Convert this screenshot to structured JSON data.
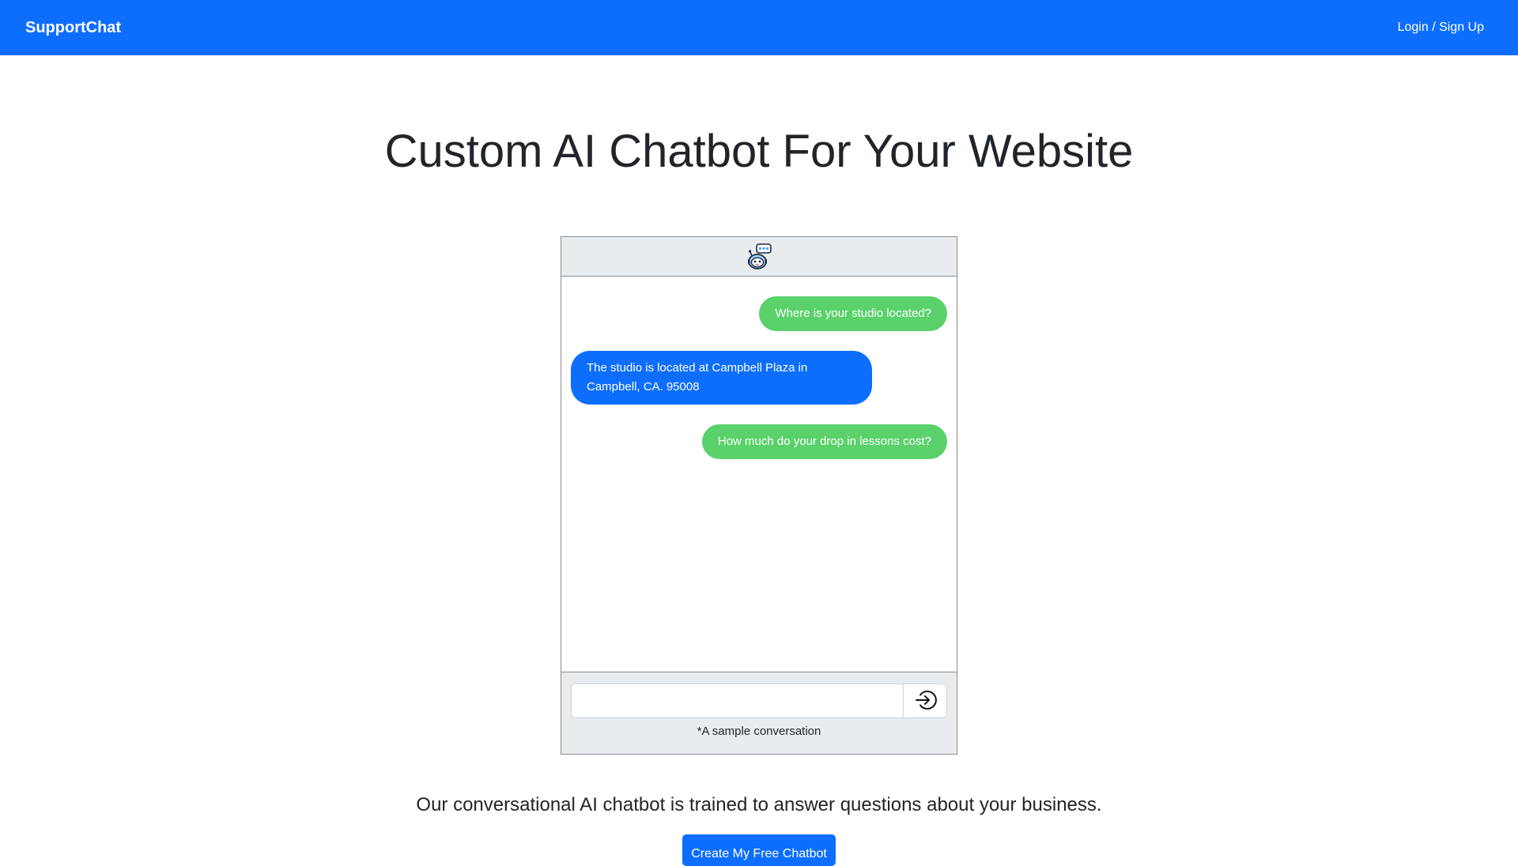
{
  "navbar": {
    "brand": "SupportChat",
    "login_link": "Login / Sign Up",
    "background_color": "#0d6efd"
  },
  "hero": {
    "title": "Custom AI Chatbot For Your Website"
  },
  "chat_widget": {
    "header_icon": "robot-avatar-icon",
    "messages": [
      {
        "sender": "user",
        "text": "Where is your studio located?",
        "color": "#5ad16a"
      },
      {
        "sender": "bot",
        "text": "The studio is located at Campbell Plaza in Campbell, CA. 95008",
        "color": "#0d6efd"
      },
      {
        "sender": "user",
        "text": "How much do your drop in lessons cost?",
        "color": "#5ad16a"
      }
    ],
    "input": {
      "value": "",
      "placeholder": ""
    },
    "send_icon": "arrow-right-circle-icon",
    "note": "*A sample conversation"
  },
  "tagline": "Our conversational AI chatbot is trained to answer questions about your business.",
  "cta": {
    "label": "Create My Free Chatbot"
  }
}
